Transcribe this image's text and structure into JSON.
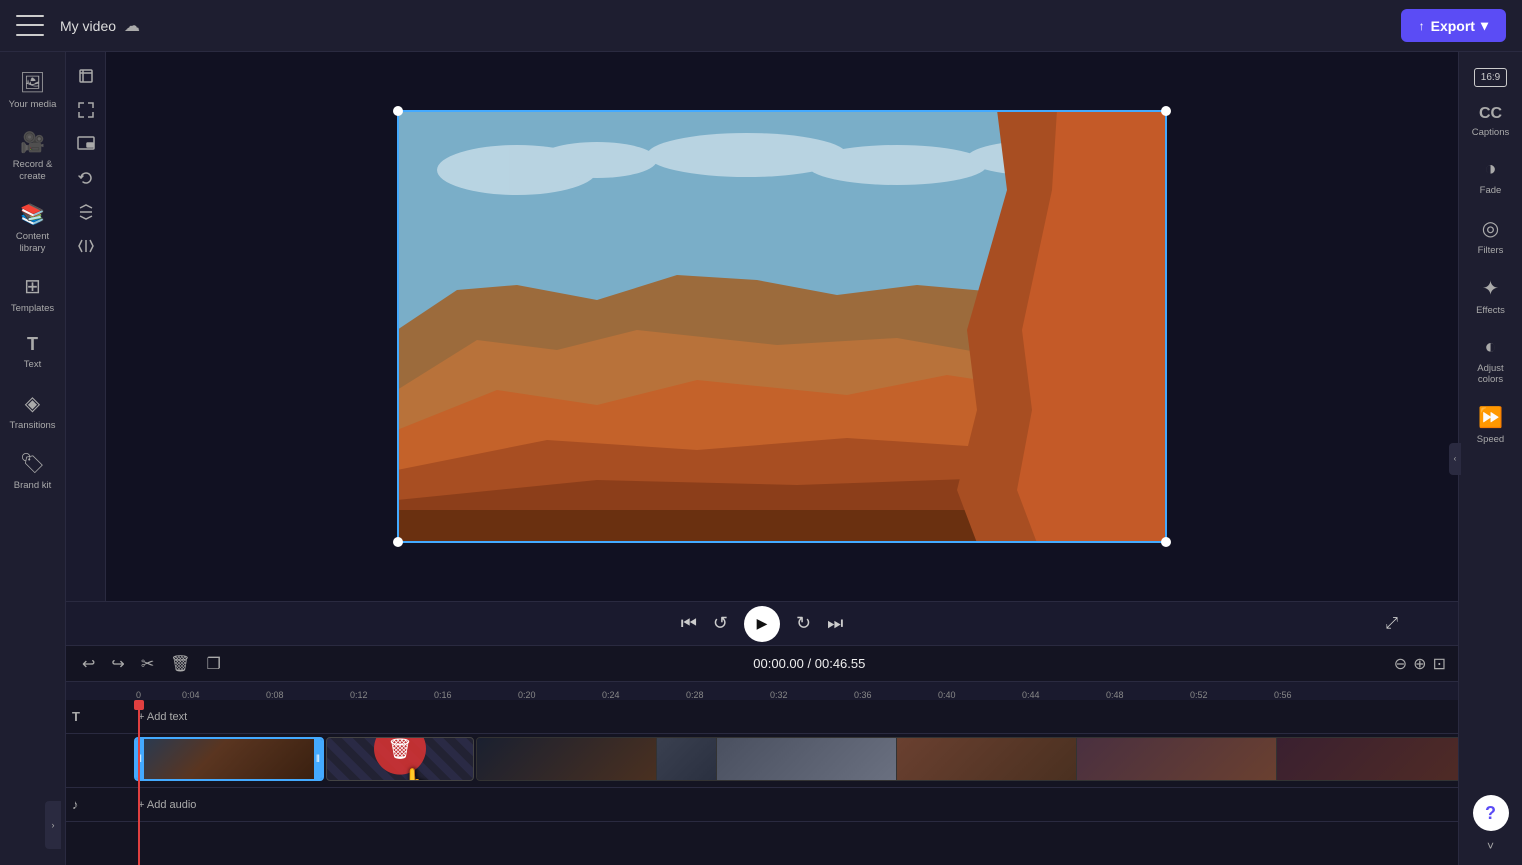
{
  "topbar": {
    "menu_label": "Menu",
    "title": "My video",
    "export_label": "Export",
    "cloud_icon": "☁"
  },
  "sidebar": {
    "items": [
      {
        "id": "your-media",
        "label": "Your media",
        "icon": "🖼"
      },
      {
        "id": "record-create",
        "label": "Record & create",
        "icon": "🎥"
      },
      {
        "id": "content-library",
        "label": "Content library",
        "icon": "📚"
      },
      {
        "id": "templates",
        "label": "Templates",
        "icon": "⊞"
      },
      {
        "id": "text",
        "label": "Text",
        "icon": "T"
      },
      {
        "id": "transitions",
        "label": "Transitions",
        "icon": "⧫"
      },
      {
        "id": "brand",
        "label": "Brand kit",
        "icon": "◈"
      }
    ]
  },
  "tools": [
    {
      "id": "crop",
      "icon": "⊡"
    },
    {
      "id": "resize",
      "icon": "⤡"
    },
    {
      "id": "picture-in-picture",
      "icon": "⊟"
    },
    {
      "id": "rotate",
      "icon": "↺"
    },
    {
      "id": "flip-v",
      "icon": "⇕"
    },
    {
      "id": "flip-h",
      "icon": "⇔"
    }
  ],
  "right_sidebar": {
    "aspect_ratio": "16:9",
    "items": [
      {
        "id": "captions",
        "label": "Captions",
        "icon": "CC"
      },
      {
        "id": "fade",
        "label": "Fade",
        "icon": "◑"
      },
      {
        "id": "filters",
        "label": "Filters",
        "icon": "◎"
      },
      {
        "id": "effects",
        "label": "Effects",
        "icon": "✦"
      },
      {
        "id": "adjust-colors",
        "label": "Adjust colors",
        "icon": "◐"
      },
      {
        "id": "speed",
        "label": "Speed",
        "icon": "⏩"
      }
    ]
  },
  "playback": {
    "skip_back_label": "Skip to start",
    "rewind_label": "Rewind",
    "play_label": "Play",
    "forward_label": "Forward",
    "skip_end_label": "Skip to end",
    "fullscreen_label": "Fullscreen"
  },
  "timeline": {
    "undo_label": "Undo",
    "redo_label": "Redo",
    "cut_label": "Cut",
    "delete_label": "Delete",
    "duplicate_label": "Duplicate",
    "current_time": "00:00.00",
    "total_time": "00:46.55",
    "zoom_out_label": "Zoom out",
    "zoom_in_label": "Zoom in",
    "fit_label": "Fit",
    "ruler_marks": [
      "0:04",
      "0:08",
      "0:12",
      "0:16",
      "0:20",
      "0:24",
      "0:28",
      "0:32",
      "0:36",
      "0:40",
      "0:44",
      "0:48",
      "0:52",
      "0:56"
    ],
    "add_text_label": "+ Add text",
    "add_audio_label": "+ Add audio",
    "delete_gap_tooltip": "Delete this gap"
  }
}
